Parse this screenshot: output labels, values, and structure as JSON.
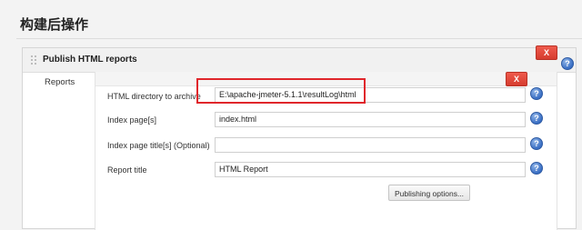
{
  "section": {
    "title": "构建后操作"
  },
  "publisher": {
    "title": "Publish HTML reports",
    "delete_label": "X"
  },
  "reports": {
    "label": "Reports",
    "delete_label": "X",
    "fields": [
      {
        "label": "HTML directory to archive",
        "value": "E:\\apache-jmeter-5.1.1\\resultLog\\html"
      },
      {
        "label": "Index page[s]",
        "value": "index.html"
      },
      {
        "label": "Index page title[s] (Optional)",
        "value": ""
      },
      {
        "label": "Report title",
        "value": "HTML Report"
      }
    ],
    "publishing_options_label": "Publishing options..."
  },
  "icons": {
    "help": "?",
    "drag_handle": "drag-handle-icon"
  },
  "colors": {
    "delete_button": "#e04a3c",
    "help_icon": "#3a6fc4",
    "highlight": "#e0262b"
  }
}
